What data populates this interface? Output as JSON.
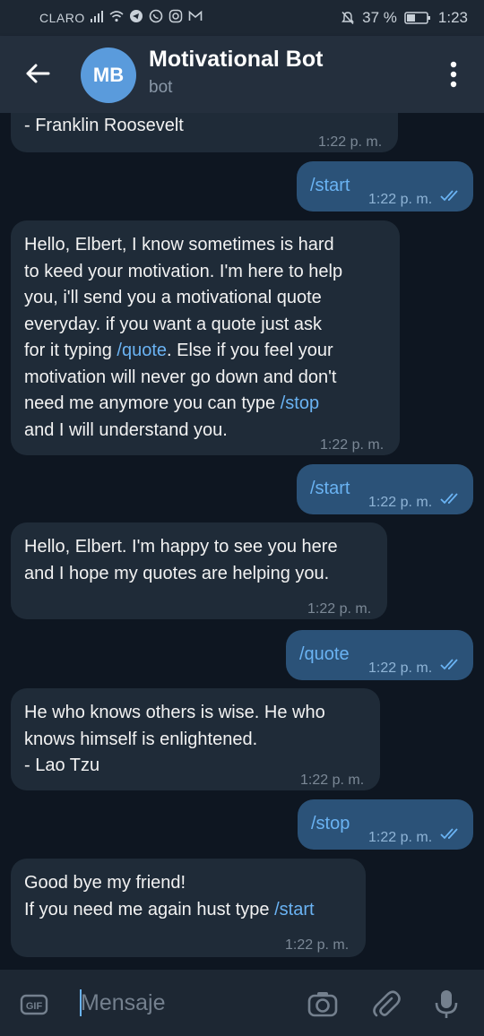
{
  "status_bar": {
    "carrier": "CLARO",
    "battery": "37 %",
    "time": "1:23"
  },
  "header": {
    "avatar_initials": "MB",
    "title": "Motivational Bot",
    "subtitle": "bot"
  },
  "messages": [
    {
      "dir": "in",
      "text": "- Franklin Roosevelt",
      "time": "1:22 p. m."
    },
    {
      "dir": "out",
      "text": "/start",
      "time": "1:22 p. m."
    },
    {
      "dir": "in",
      "text": "Hello, Elbert, I know sometimes is hard to keed your motivation. I'm here to help you, i'll send you a motivational quote everyday. if you want a quote just ask for it typing /quote. Else if you feel your motivation will never go down and don't need me anymore you can type /stop and I will understand you.",
      "time": "1:22 p. m."
    },
    {
      "dir": "out",
      "text": "/start",
      "time": "1:22 p. m."
    },
    {
      "dir": "in",
      "text": "Hello, Elbert. I'm happy to see you here and I hope my quotes are helping you.",
      "time": "1:22 p. m."
    },
    {
      "dir": "out",
      "text": "/quote",
      "time": "1:22 p. m."
    },
    {
      "dir": "in",
      "text": "He who knows others is wise. He who knows himself is enlightened.\n- Lao Tzu",
      "time": "1:22 p. m."
    },
    {
      "dir": "out",
      "text": "/stop",
      "time": "1:22 p. m."
    },
    {
      "dir": "in",
      "text": "Good bye my friend!\nIf you need me again hust type /start",
      "time": "1:22 p. m."
    }
  ],
  "msg2_parts": {
    "l1": "Hello, Elbert, I know sometimes is hard",
    "l2": "to keed your motivation. I'm here to help",
    "l3": "you, i'll send you a motivational quote",
    "l4": "everyday. if you want a quote just ask",
    "l5a": "for it typing ",
    "l5cmd": "/quote",
    "l5b": ". Else if you feel your",
    "l6": "motivation will never go down and don't",
    "l7a": "need me anymore you can type ",
    "l7cmd": "/stop",
    "l8": "and I will understand you."
  },
  "msg5_parts": {
    "l1": "He who knows others is wise. He who",
    "l2": "knows himself is enlightened.",
    "l3": "- Lao Tzu"
  },
  "msg7_parts": {
    "l1": "Good bye my friend!",
    "l2a": "If you need me again hust type ",
    "l2cmd": "/start"
  },
  "msg4_parts": {
    "l1": "Hello, Elbert. I'm happy to see you here",
    "l2": "and I hope my quotes are helping you."
  },
  "input": {
    "placeholder": "Mensaje"
  },
  "icons": [
    "back-arrow-icon",
    "more-vertical-icon",
    "gif-icon",
    "camera-icon",
    "attach-icon",
    "microphone-icon",
    "double-check-icon"
  ]
}
